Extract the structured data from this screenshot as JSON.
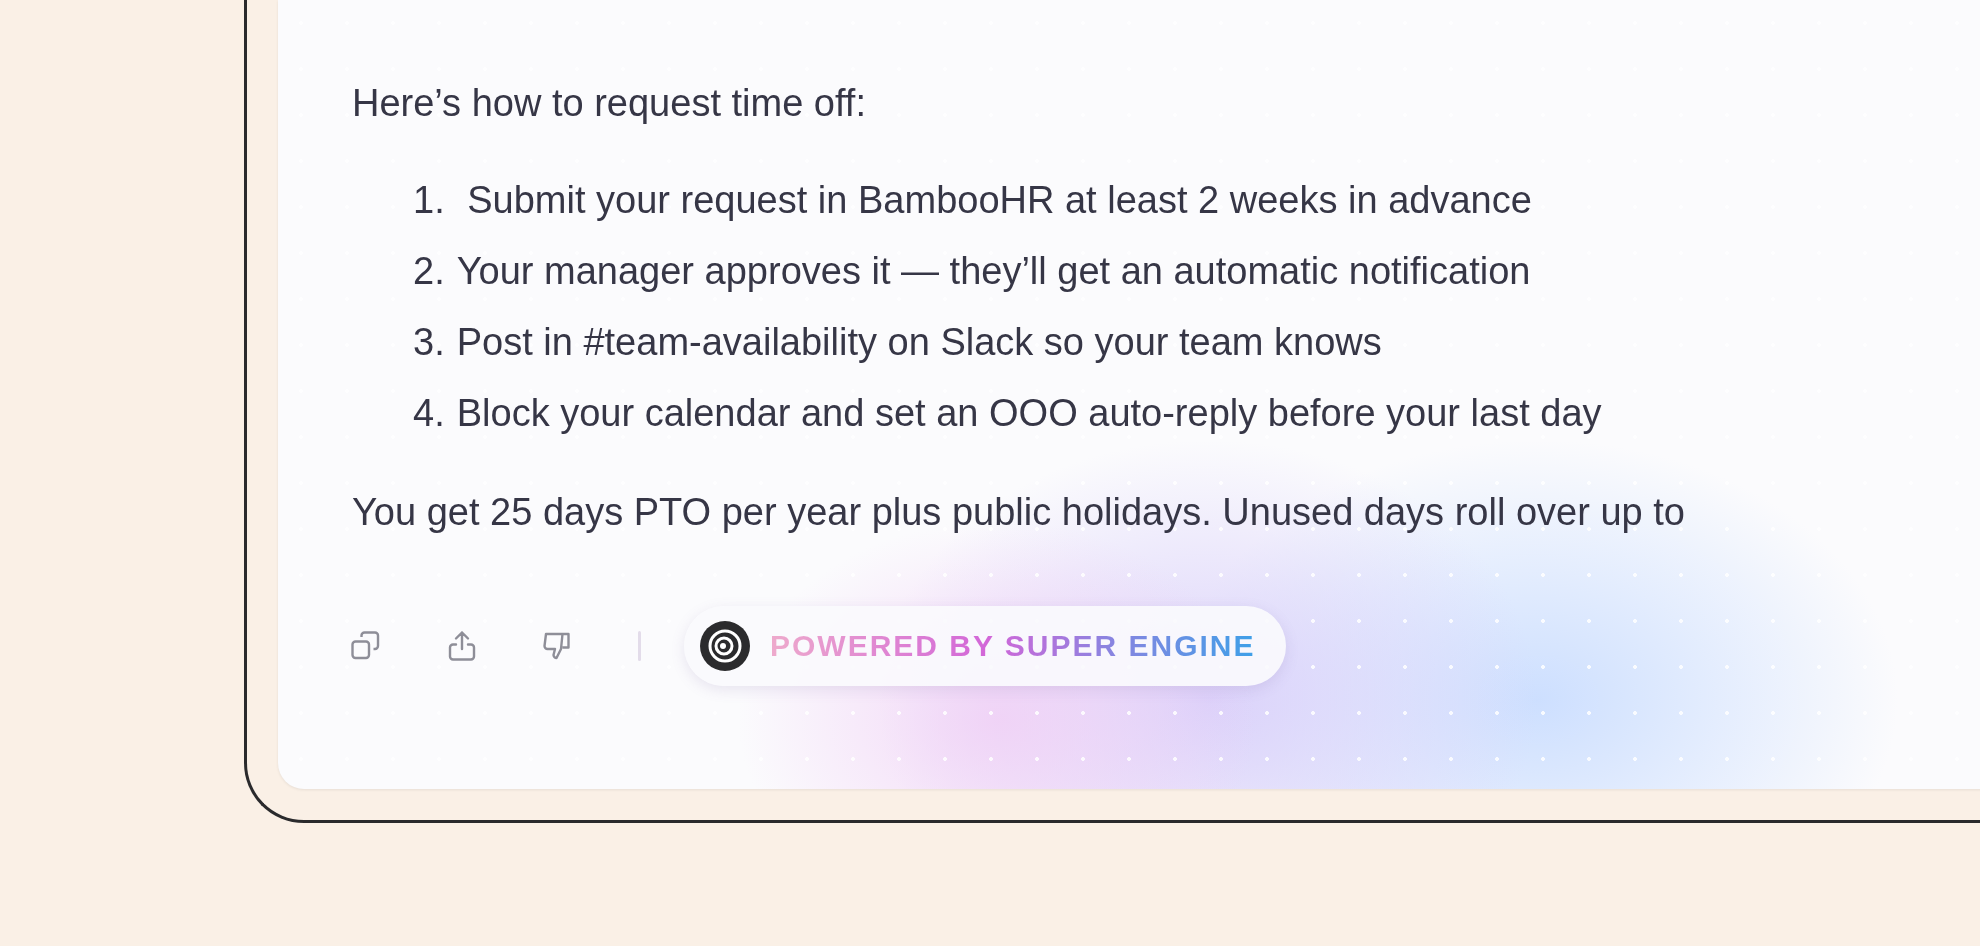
{
  "message": {
    "intro": "Here’s how to request time off:",
    "steps": [
      {
        "number": "1.",
        "text": " Submit your request in BambooHR at least 2 weeks in advance"
      },
      {
        "number": "2.",
        "text": "Your manager approves it — they’ll get an automatic notification"
      },
      {
        "number": "3.",
        "text": "Post in #team-availability on Slack so your team knows"
      },
      {
        "number": "4.",
        "text": "Block your calendar and set an OOO auto-reply before your last day"
      }
    ],
    "closing": "You get 25 days PTO per year plus public holidays. Unused days roll over up to"
  },
  "actions": [
    {
      "kind": "copy"
    },
    {
      "kind": "share"
    },
    {
      "kind": "dislike"
    }
  ],
  "badge": {
    "text": "POWERED BY SUPER ENGINE"
  }
}
